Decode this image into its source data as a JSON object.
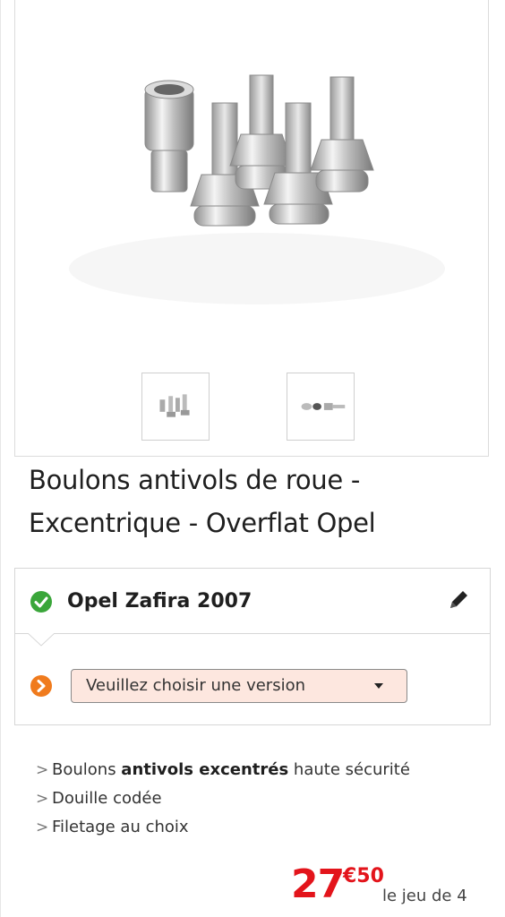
{
  "product": {
    "title_line1": "Boulons antivols de roue -",
    "title_line2": "Excentrique - Overflat Opel",
    "main_image_icon": "wheel-lock-bolts-image",
    "thumbnails": [
      {
        "icon": "bolts-set-thumbnail"
      },
      {
        "icon": "bolt-and-key-thumbnail"
      }
    ]
  },
  "vehicle": {
    "name": "Opel Zafira 2007",
    "status_icon": "check-icon",
    "edit_icon": "pencil-icon",
    "version_icon": "arrow-right-circle-icon",
    "version_placeholder": "Veuillez choisir une version"
  },
  "features": [
    {
      "pre": "Boulons ",
      "bold": "antivols excentrés",
      "post": " haute sécurité"
    },
    {
      "pre": "Douille codée",
      "bold": "",
      "post": ""
    },
    {
      "pre": "Filetage au choix",
      "bold": "",
      "post": ""
    }
  ],
  "price": {
    "integer": "27",
    "decimal": "€50",
    "unit": "le jeu de 4"
  },
  "colors": {
    "accent_red": "#e3141b",
    "check_green": "#3aa63a",
    "arrow_orange": "#f07b1d",
    "select_bg": "#fde7df"
  }
}
